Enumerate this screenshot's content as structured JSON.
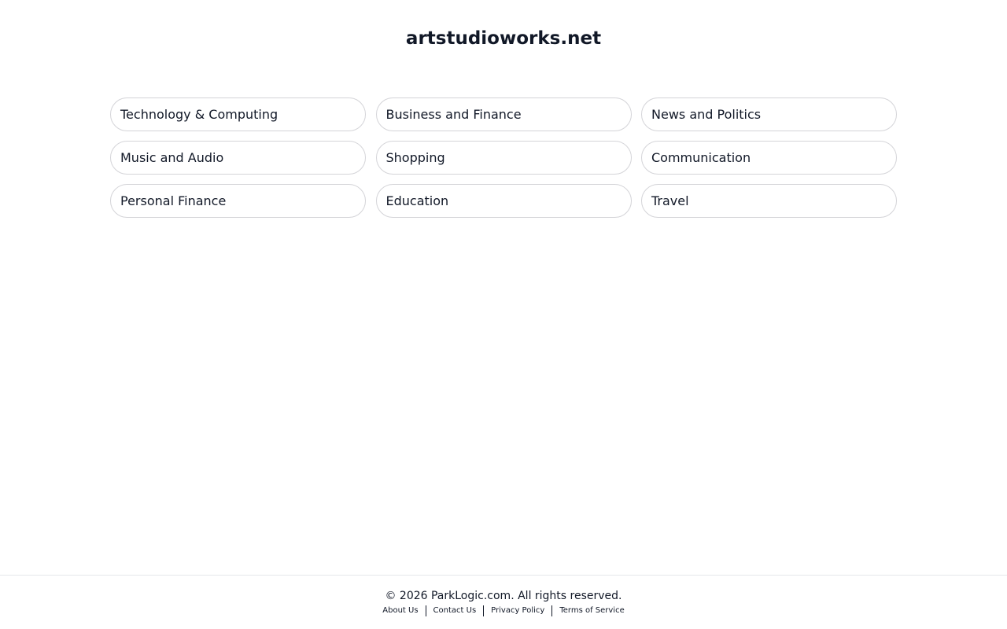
{
  "header": {
    "title": "artstudioworks.net"
  },
  "categories": [
    {
      "label": "Technology & Computing"
    },
    {
      "label": "Business and Finance"
    },
    {
      "label": "News and Politics"
    },
    {
      "label": "Music and Audio"
    },
    {
      "label": "Shopping"
    },
    {
      "label": "Communication"
    },
    {
      "label": "Personal Finance"
    },
    {
      "label": "Education"
    },
    {
      "label": "Travel"
    }
  ],
  "footer": {
    "copyright": "© 2026 ParkLogic.com. All rights reserved.",
    "links": [
      {
        "label": "About Us"
      },
      {
        "label": "Contact Us"
      },
      {
        "label": "Privacy Policy"
      },
      {
        "label": "Terms of Service"
      }
    ]
  }
}
